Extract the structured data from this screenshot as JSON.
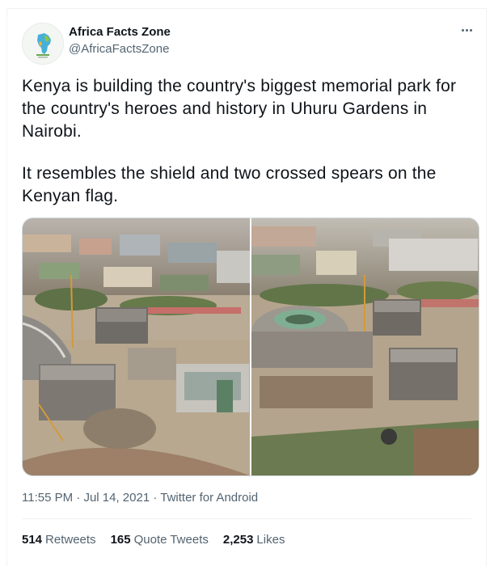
{
  "account": {
    "name": "Africa Facts Zone",
    "handle": "@AfricaFactsZone",
    "avatar_icon": "africa-map-logo-icon"
  },
  "menu_icon": "more-options-icon",
  "tweet": {
    "paragraph1": "Kenya is building the country's biggest memorial park for the country's heroes and history in Uhuru Gardens in Nairobi.",
    "paragraph2": "It resembles the shield and two crossed spears  on the Kenyan flag."
  },
  "media": {
    "count": 2
  },
  "meta": {
    "time": "11:55 PM",
    "date": "Jul 14, 2021",
    "source": "Twitter for Android",
    "separator": "·"
  },
  "stats": {
    "retweets_count": "514",
    "retweets_label": "Retweets",
    "quotes_count": "165",
    "quotes_label": "Quote Tweets",
    "likes_count": "2,253",
    "likes_label": "Likes"
  }
}
